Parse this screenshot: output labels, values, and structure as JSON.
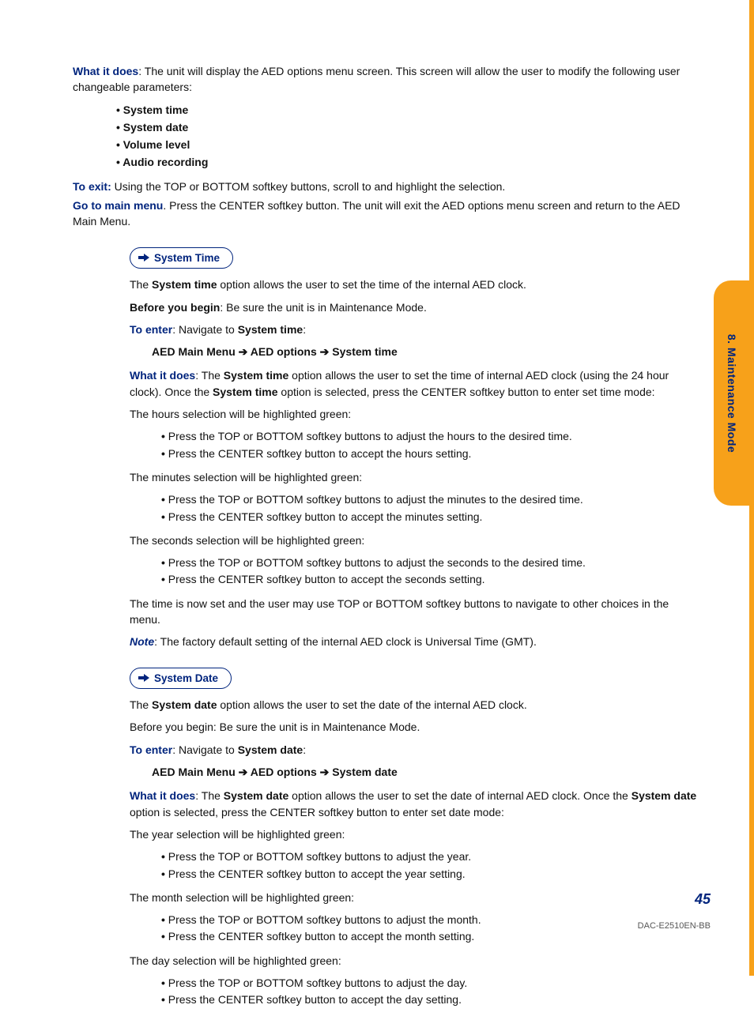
{
  "side_tab": "8. Maintenance Mode",
  "page_number": "45",
  "doc_code": "DAC-E2510EN-BB",
  "what_it_does_label": "What it does",
  "what_it_does_text": ": The unit will display the AED options menu screen. This screen will allow the user to modify the following user changeable parameters:",
  "params": [
    "System time",
    "System date",
    "Volume level",
    "Audio recording"
  ],
  "to_exit_label": "To exit:",
  "to_exit_text": " Using the TOP or BOTTOM softkey buttons, scroll to and highlight the selection.",
  "go_main_label": "Go to main menu",
  "go_main_text": ".  Press the CENTER softkey button.  The unit will exit the AED options menu screen and return to the AED Main Menu.",
  "pill_time": "System Time",
  "time_intro_pre": "The ",
  "time_intro_bold": "System time",
  "time_intro_post": " option allows the user to set the time of the internal AED clock.",
  "before_you_begin_label": "Before you begin",
  "before_you_begin_text": ": Be sure the unit is in Maintenance Mode.",
  "to_enter_label": "To enter",
  "to_enter_time_text": ": Navigate to ",
  "to_enter_time_target": "System time",
  "path_time_a": "AED Main Menu",
  "path_arrow": " ➔ ",
  "path_time_b": "AED options",
  "path_time_c": "System time",
  "time_body_pre": ": The ",
  "time_body_bold1": "System time",
  "time_body_mid": " option allows the user to set the time of internal AED clock (using the 24 hour clock).  Once the ",
  "time_body_bold2": "System time",
  "time_body_post": " option is selected, press the CENTER softkey button to enter set time mode:",
  "hours_label": "The hours selection will be highlighted green:",
  "hours_b1": "Press the TOP or BOTTOM softkey buttons to adjust the hours to the desired time.",
  "hours_b2": "Press the CENTER softkey button to accept the hours setting.",
  "minutes_label": "The minutes selection will be highlighted green:",
  "minutes_b1": "Press the TOP or BOTTOM softkey buttons to adjust the minutes to the desired time.",
  "minutes_b2": "Press the CENTER softkey button to accept the minutes setting.",
  "seconds_label": "The seconds selection will be highlighted green:",
  "seconds_b1": "Press the TOP or BOTTOM softkey buttons to adjust the seconds to the desired time.",
  "seconds_b2": "Press the CENTER softkey button to accept the seconds setting.",
  "time_set_done": "The time is now set and the user may use TOP or BOTTOM softkey buttons to navigate to other choices in the menu.",
  "note_label": "Note",
  "note_text": ": The factory default setting of the internal AED clock is Universal Time (GMT).",
  "pill_date": "System Date",
  "date_intro_pre": "The ",
  "date_intro_bold": "System date",
  "date_intro_post": " option allows the user to set the date of the internal AED clock.",
  "date_before": "Before you begin: Be sure the unit is in Maintenance Mode.",
  "to_enter_date_text": ": Navigate to ",
  "to_enter_date_target": "System date",
  "path_date_c": "System date",
  "date_body_pre": ": The ",
  "date_body_bold1": "System date",
  "date_body_mid": " option allows the user to set the date of internal AED clock.  Once the ",
  "date_body_bold2": "System date",
  "date_body_post": " option is selected, press the CENTER softkey button to enter set date mode:",
  "year_label": "The year selection will be highlighted green:",
  "year_b1": "Press the TOP or BOTTOM softkey buttons to adjust the year.",
  "year_b2": "Press the CENTER softkey button to accept the year setting.",
  "month_label": "The month selection will be highlighted green:",
  "month_b1": "Press the TOP or BOTTOM softkey buttons to adjust the month.",
  "month_b2": "Press the CENTER softkey button to accept the month setting.",
  "day_label": "The day selection will be highlighted green:",
  "day_b1": "Press the TOP or BOTTOM softkey buttons to adjust the day.",
  "day_b2": "Press the CENTER softkey button to accept the day setting."
}
